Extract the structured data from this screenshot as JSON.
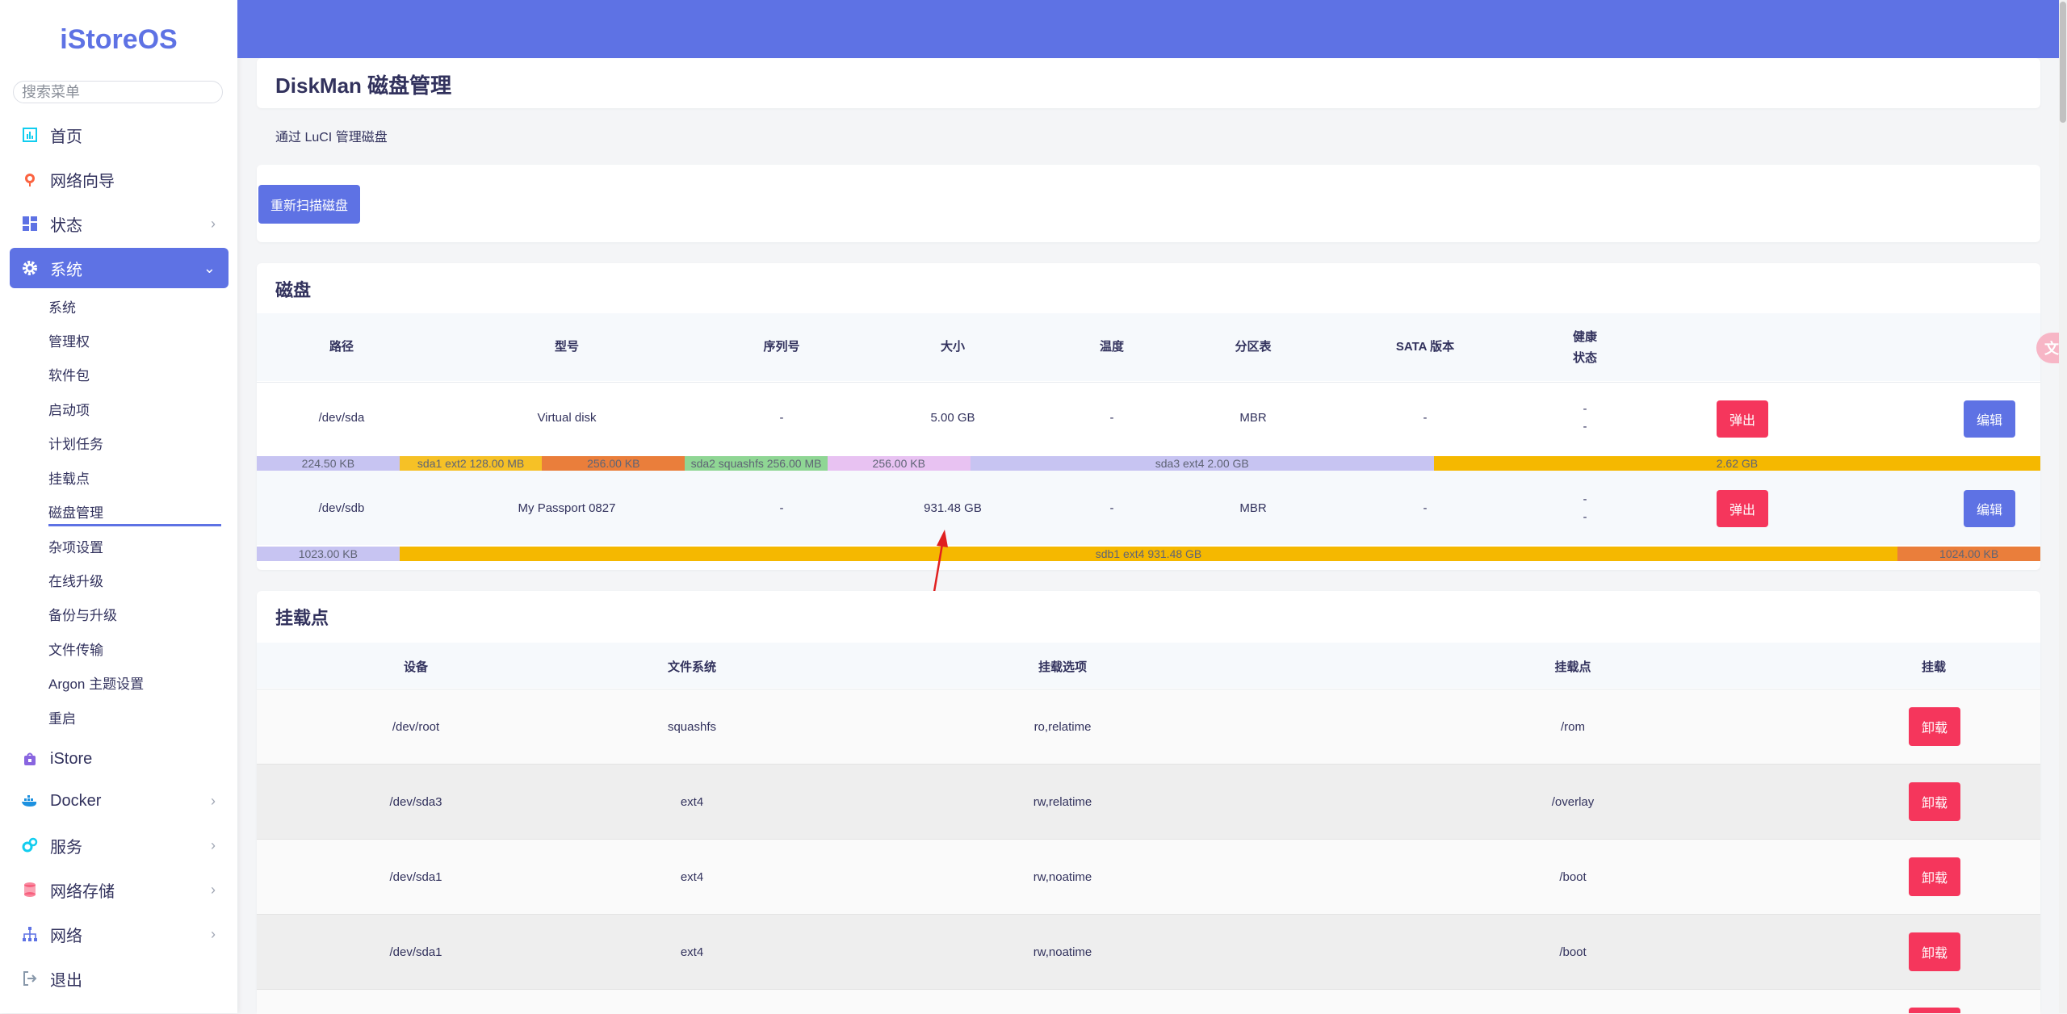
{
  "brand": "iStoreOS",
  "search": {
    "placeholder": "搜索菜单"
  },
  "nav": [
    {
      "label": "首页",
      "icon": "chart-icon",
      "chevron": false
    },
    {
      "label": "网络向导",
      "icon": "globe-icon",
      "chevron": false
    },
    {
      "label": "状态",
      "icon": "dashboard-icon",
      "chevron": true
    },
    {
      "label": "系统",
      "icon": "gear-icon",
      "chevron": true,
      "active": true
    }
  ],
  "system_sub": [
    "系统",
    "管理权",
    "软件包",
    "启动项",
    "计划任务",
    "挂载点",
    "磁盘管理",
    "杂项设置",
    "在线升级",
    "备份与升级",
    "文件传输",
    "Argon 主题设置",
    "重启"
  ],
  "nav_bottom": [
    {
      "label": "iStore",
      "icon": "store-icon",
      "chevron": false
    },
    {
      "label": "Docker",
      "icon": "docker-icon",
      "chevron": true
    },
    {
      "label": "服务",
      "icon": "services-icon",
      "chevron": true
    },
    {
      "label": "网络存储",
      "icon": "storage-icon",
      "chevron": true
    },
    {
      "label": "网络",
      "icon": "network-icon",
      "chevron": true
    },
    {
      "label": "退出",
      "icon": "logout-icon",
      "chevron": false
    }
  ],
  "page": {
    "title": "DiskMan 磁盘管理",
    "description": "通过 LuCI 管理磁盘",
    "rescan_label": "重新扫描磁盘"
  },
  "disks": {
    "title": "磁盘",
    "headers": [
      "路径",
      "型号",
      "序列号",
      "大小",
      "温度",
      "分区表",
      "SATA 版本",
      "健康",
      "状态"
    ],
    "eject_label": "弹出",
    "edit_label": "编辑",
    "rows": [
      {
        "path": "/dev/sda",
        "model": "Virtual disk",
        "serial": "-",
        "size": "5.00 GB",
        "temp": "-",
        "table": "MBR",
        "sata": "-",
        "health": "-",
        "status": "-",
        "partitions": [
          {
            "label": "224.50 KB",
            "color": "#c7c4f2",
            "width": 8
          },
          {
            "label": "sda1 ext2 128.00 MB",
            "color": "#f6c126",
            "width": 8
          },
          {
            "label": "256.00 KB",
            "color": "#ea7e3b",
            "width": 8
          },
          {
            "label": "sda2 squashfs 256.00 MB",
            "color": "#8fd694",
            "width": 8
          },
          {
            "label": "256.00 KB",
            "color": "#e8c2f2",
            "width": 8
          },
          {
            "label": "sda3 ext4 2.00 GB",
            "color": "#c7c4f2",
            "width": 26
          },
          {
            "label": "2.62 GB",
            "color": "#f5b800",
            "width": 34
          }
        ]
      },
      {
        "path": "/dev/sdb",
        "model": "My Passport 0827",
        "serial": "-",
        "size": "931.48 GB",
        "temp": "-",
        "table": "MBR",
        "sata": "-",
        "health": "-",
        "status": "-",
        "partitions": [
          {
            "label": "1023.00 KB",
            "color": "#c7c4f2",
            "width": 8
          },
          {
            "label": "sdb1 ext4 931.48 GB",
            "color": "#f5b800",
            "width": 84
          },
          {
            "label": "1024.00 KB",
            "color": "#ea7e3b",
            "width": 8
          }
        ]
      }
    ]
  },
  "mounts": {
    "title": "挂载点",
    "headers": [
      "设备",
      "文件系统",
      "挂载选项",
      "挂载点",
      "挂载"
    ],
    "unmount_label": "卸载",
    "rows": [
      {
        "device": "/dev/root",
        "fs": "squashfs",
        "options": "ro,relatime",
        "mount": "/rom"
      },
      {
        "device": "/dev/sda3",
        "fs": "ext4",
        "options": "rw,relatime",
        "mount": "/overlay"
      },
      {
        "device": "/dev/sda1",
        "fs": "ext4",
        "options": "rw,noatime",
        "mount": "/boot"
      },
      {
        "device": "/dev/sda1",
        "fs": "ext4",
        "options": "rw,noatime",
        "mount": "/boot"
      }
    ]
  },
  "translate_badge": "文"
}
